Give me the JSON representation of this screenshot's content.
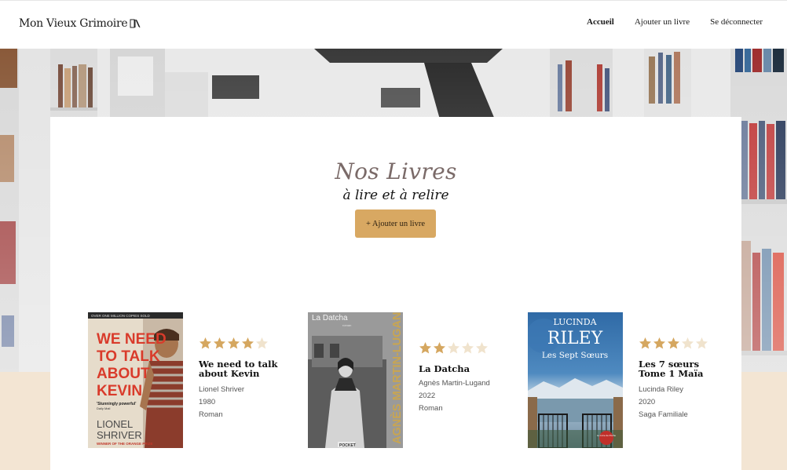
{
  "header": {
    "logo_text": "Mon Vieux Grimoire",
    "nav": [
      {
        "label": "Accueil",
        "active": true
      },
      {
        "label": "Ajouter un livre",
        "active": false
      },
      {
        "label": "Se déconnecter",
        "active": false
      }
    ]
  },
  "main": {
    "title": "Nos Livres",
    "subtitle": "à lire et à relire",
    "add_button_label": "+ Ajouter un livre"
  },
  "books": [
    {
      "rating": 4,
      "title_line1": "We need to talk",
      "title_line2": "about Kevin",
      "author": "Lionel Shriver",
      "year": "1980",
      "genre": "Roman",
      "cover": {
        "top_text": "OVER ONE MILLION COPIES SOLD",
        "title_lines": [
          "WE NEED",
          "TO TALK",
          "ABOUT",
          "KEVIN"
        ],
        "quote": "'Stunningly powerful'",
        "quote_source": "Daily Mail",
        "author_lines": [
          "LIONEL",
          "SHRIVER"
        ],
        "award": "WINNER OF THE ORANGE PRIZE"
      }
    },
    {
      "rating": 2,
      "title_line1": "La Datcha",
      "title_line2": "",
      "author": "Agnès Martin-Lugand",
      "year": "2022",
      "genre": "Roman",
      "cover": {
        "top_text": "La Datcha",
        "small_text": "roman",
        "side_author": "AGNÈS MARTIN-LUGAND",
        "publisher": "POCKET"
      }
    },
    {
      "rating": 3,
      "title_line1": "Les 7 sœurs",
      "title_line2": "Tome 1 Maïa",
      "author": "Lucinda Riley",
      "year": "2020",
      "genre": "Saga Familiale",
      "cover": {
        "author_small": "LUCINDA",
        "author_big": "RILEY",
        "title": "Les Sept Sœurs",
        "publisher_badge": "Le Livre de Poche"
      }
    }
  ],
  "colors": {
    "accent": "#d8a862",
    "star_filled": "#d5a760",
    "star_empty": "#f0e3cd",
    "title_color": "#7a6a68",
    "page_bg": "#f3e5d3"
  },
  "icons": {
    "logo": "open-book-icon",
    "rating": "star-icon"
  }
}
